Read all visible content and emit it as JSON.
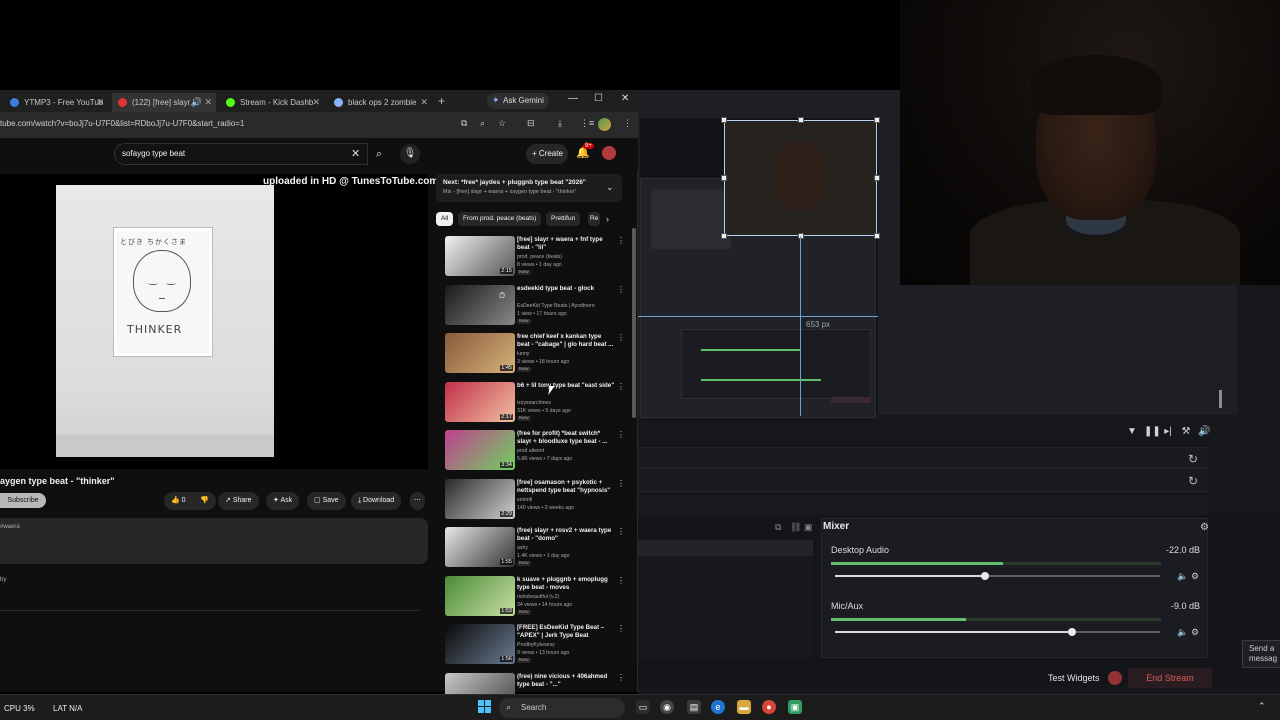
{
  "browser": {
    "tabs": [
      {
        "label": "YTMP3 - Free YouTub",
        "color": "#3d7de0"
      },
      {
        "label": "(122) [free] slayr",
        "color": "#e03434",
        "active": true
      },
      {
        "label": "Stream - Kick Dashb",
        "color": "#53fc18"
      },
      {
        "label": "black ops 2 zombie",
        "color": "#8ab4f8"
      }
    ],
    "ask_gemini": "Ask Gemini",
    "url": "tube.com/watch?v=boJj7u-U7F0&list=RDboJj7u-U7F0&start_radio=1"
  },
  "youtube": {
    "search_query": "sofaygo type beat",
    "create_label": "Create",
    "bell_count": "9+",
    "watermark": "uploaded in HD @ TunesToTube.com",
    "artwork": {
      "top_text": "とびき ちかくさま",
      "word": "THINKER"
    },
    "video_title": "aygen type beat - \"thinker\"",
    "subscribe_label": "Subscribe",
    "actions": {
      "likes": "0",
      "share": "Share",
      "ask": "Ask",
      "save": "Save",
      "download": "Download"
    },
    "description_tag": "#waera",
    "description_by": "by",
    "next_mix": {
      "title": "Next: *free* jaydes + pluggnb type beat \"2026\"",
      "subtitle": "Mix - [free] slayr + waera + ssygen type beat - \"thinker\""
    },
    "chips": [
      "All",
      "From prod. peace (beats)",
      "Prettifun",
      "Re"
    ],
    "related": [
      {
        "title": "[free] slayr + waera + fnf type beat - \"lil\"",
        "channel": "prod. peace (beats)",
        "meta": "8 views • 1 day ago",
        "badge": "New",
        "duration": "2:15"
      },
      {
        "title": "esdeekid type beat - glock",
        "channel": "EsDeeKid Type Beats | Ayodinero",
        "meta": "1 view • 17 hours ago",
        "badge": "New",
        "duration": ""
      },
      {
        "title": "free chief keef x kankan type beat - \"cabage\" | glo hard beat ...",
        "channel": "lunny",
        "meta": "3 views • 18 hours ago",
        "badge": "New",
        "duration": "1:45"
      },
      {
        "title": "b6 + lil tony type beat \"east side\"",
        "channel": "izzysearchines",
        "meta": "31K views • 5 days ago",
        "badge": "New",
        "duration": "2:17"
      },
      {
        "title": "(free for profit) *beat switch* slayr + bloodluxe type beat - ...",
        "channel": "prod.alieent",
        "meta": "5.6K views • 7 days ago",
        "badge": "",
        "duration": "3:34"
      },
      {
        "title": "[free] osamason + psykotic + nettspend type beat \"hypnosis\"",
        "channel": "setoriti",
        "meta": "140 views • 2 weeks ago",
        "badge": "",
        "duration": "2:29"
      },
      {
        "title": "(free) slayr + rosv2 + waera type beat - \"domo\"",
        "channel": "ashy",
        "meta": "1.4K views • 1 day ago",
        "badge": "New",
        "duration": "1:55"
      },
      {
        "title": "k suave + pluggnb + emoplugg type beat - moves",
        "channel": "rishobeautiful (v.2)",
        "meta": "34 views • 14 hours ago",
        "badge": "New",
        "duration": "1:53"
      },
      {
        "title": "[FREE] EsDeeKid Type Beat – \"APEX\" | Jerk Type Beat",
        "channel": "ProdbyKykearsy",
        "meta": "9 views • 13 hours ago",
        "badge": "New",
        "duration": "1:56"
      },
      {
        "title": "(free) nine vicious + 406ahmed type beat - \"...\"",
        "channel": "",
        "meta": "",
        "badge": "",
        "duration": ""
      }
    ]
  },
  "obs": {
    "canvas_px_readout": "653 px",
    "mixer_title": "Mixer",
    "tracks": [
      {
        "name": "Desktop Audio",
        "db": "-22.0 dB",
        "meter": 0.52,
        "volume": 0.46
      },
      {
        "name": "Mic/Aux",
        "db": "-9.0 dB",
        "meter": 0.41,
        "volume": 0.73
      }
    ],
    "test_widgets": "Test Widgets",
    "end_stream": "End Stream",
    "send_message": "Send a messag"
  },
  "taskbar": {
    "cpu": "CPU  3%",
    "lat": "LAT  N/A",
    "search_placeholder": "Search"
  }
}
